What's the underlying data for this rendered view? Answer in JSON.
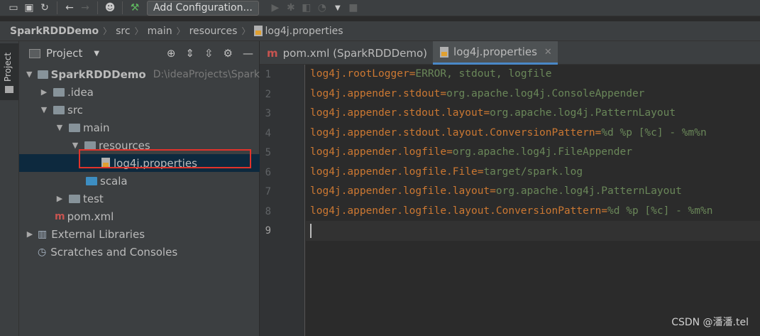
{
  "toolbar": {
    "icons": [
      "open-folder-icon",
      "save-icon",
      "sync-icon",
      "back-icon",
      "forward-icon",
      "user-icon",
      "build-hammer-icon",
      "run-icon",
      "debug-icon",
      "coverage-icon",
      "profile-icon",
      "stop-icon"
    ],
    "run_config_label": "Add Configuration..."
  },
  "breadcrumb": [
    "SparkRDDDemo",
    "src",
    "main",
    "resources",
    "log4j.properties"
  ],
  "side_strip": {
    "label": "Project"
  },
  "project_panel": {
    "title": "Project",
    "tree": [
      {
        "label": "SparkRDDDemo",
        "hint": "D:\\ideaProjects\\Spark"
      },
      {
        "label": ".idea"
      },
      {
        "label": "src"
      },
      {
        "label": "main"
      },
      {
        "label": "resources"
      },
      {
        "label": "log4j.properties"
      },
      {
        "label": "scala"
      },
      {
        "label": "test"
      },
      {
        "label": "pom.xml"
      },
      {
        "label": "External Libraries"
      },
      {
        "label": "Scratches and Consoles"
      }
    ]
  },
  "editor_tabs": [
    {
      "label": "pom.xml (SparkRDDDemo)",
      "active": false
    },
    {
      "label": "log4j.properties",
      "active": true
    }
  ],
  "editor": {
    "lines": [
      {
        "num": "1",
        "key": "log4j.rootLogger",
        "eq": "=",
        "val": "ERROR, stdout, logfile"
      },
      {
        "num": "2",
        "key": "log4j.appender.stdout",
        "eq": "=",
        "val": "org.apache.log4j.ConsoleAppender"
      },
      {
        "num": "3",
        "key": "log4j.appender.stdout.layout",
        "eq": "=",
        "val": "org.apache.log4j.PatternLayout"
      },
      {
        "num": "4",
        "key": "log4j.appender.stdout.layout.ConversionPattern",
        "eq": "=",
        "val": "%d %p [%c] - %m%n"
      },
      {
        "num": "5",
        "key": "log4j.appender.logfile",
        "eq": "=",
        "val": "org.apache.log4j.FileAppender"
      },
      {
        "num": "6",
        "key": "log4j.appender.logfile.File",
        "eq": "=",
        "val": "target/spark.log"
      },
      {
        "num": "7",
        "key": "log4j.appender.logfile.layout",
        "eq": "=",
        "val": "org.apache.log4j.PatternLayout"
      },
      {
        "num": "8",
        "key": "log4j.appender.logfile.layout.ConversionPattern",
        "eq": "=",
        "val": "%d %p [%c] - %m%n"
      },
      {
        "num": "9",
        "key": "",
        "eq": "",
        "val": ""
      }
    ]
  },
  "watermark": "CSDN @潘潘.tel",
  "colors": {
    "key": "#cc7832",
    "value": "#6a8759",
    "highlight_box": "#e0332b",
    "selection": "#0d293e"
  }
}
